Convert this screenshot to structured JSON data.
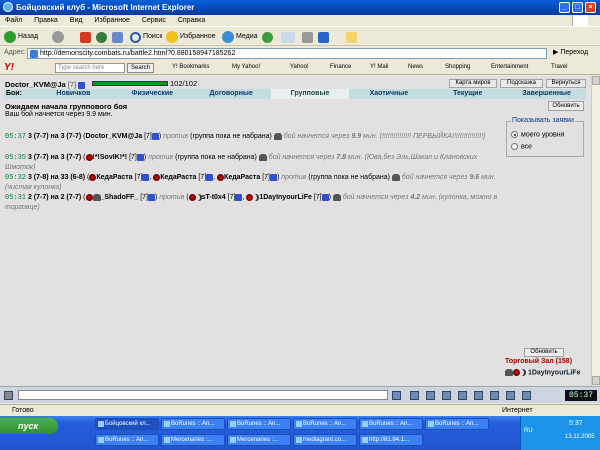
{
  "window": {
    "title": "Бойцовский клуб - Microsoft Internet Explorer"
  },
  "menu": [
    "Файл",
    "Правка",
    "Вид",
    "Избранное",
    "Сервис",
    "Справка"
  ],
  "toolbar": {
    "back": "Назад",
    "search": "Поиск",
    "favorites": "Избранное",
    "media": "Медиа"
  },
  "address": {
    "label": "Адрес:",
    "url": "http://demonscity.combats.ru/battle2.html?0.880158947185262",
    "go": "Переход"
  },
  "yahoo": {
    "logo": "Y!",
    "search_placeholder": "Type search here",
    "search_button": "Search",
    "links": [
      "Y! Bookmarks",
      "My Yahoo!",
      "Yahoo!",
      "Finance",
      "Y! Mail",
      "News",
      "Shopping",
      "Entertainment",
      "Travel"
    ]
  },
  "game": {
    "player": {
      "name": "Doctor_KVM@Ja",
      "level": "[7]",
      "hp": "102/102",
      "hp_fraction": 1.0
    },
    "top_buttons": [
      "Карта миров",
      "Подсказка",
      "Вернуться"
    ],
    "tabs_label": "Бои:",
    "tabs": [
      "Новичков",
      "Физические",
      "Договорные",
      "Групповые",
      "Хаотичные",
      "Текущие",
      "Завершенные"
    ],
    "active_tab": "Групповые",
    "wait_title": "Ожидаем начала группового боя",
    "wait_sub": "Ваш бой начнется через 9.9 мин.",
    "refresh": "Обновить",
    "filter": {
      "legend": "Показывать заявки",
      "opt1": "моего уровня",
      "opt2": "все"
    },
    "battles": [
      {
        "time": "05:37",
        "head": "3 (7-7) на 3 (7-7)",
        "p1": "Doctor_KVM@Ja",
        "p1lvl": "[7]",
        "vs": "против",
        "group": "(группа пока не набрана)",
        "start": "бой начнется через",
        "mins": "9.9",
        "unit": "мин.",
        "comment": "(!!!!!!!!!!!!!!! ПЕРВЫЙКА!!!!!!!!!!!!!!!!)"
      },
      {
        "time": "05:35",
        "head": "3 (7-7) на 3 (7-7)",
        "p1": "!*!SovIK!*!",
        "p1lvl": "[7]",
        "vs": "против",
        "group": "(группа пока не набрана)",
        "start": "бой начнется через",
        "mins": "7.8",
        "unit": "мин.",
        "comment": "(Юва,без Эль,Шакал и Клановских Шмоток)"
      },
      {
        "time": "05:32",
        "head": "3 (7-8) на 33 (6-8)",
        "p1": "КедаРаста",
        "p1lvl": "[7]",
        "p2": "КедаРаста",
        "p2lvl": "[7]",
        "p3": "КедаРаста",
        "p3lvl": "[7]",
        "vs": "против",
        "group": "(группа пока не набрана)",
        "start": "бой начнется через",
        "mins": "9.6",
        "unit": "мин.",
        "comment": "(чистая кулонка)"
      },
      {
        "time": "05:31",
        "head": "2 (7-7) на 2 (7-7)",
        "p1": "_ShadoFF_",
        "p1lvl": "[7]",
        "vs": "против",
        "p2": "sT-t0x4",
        "p2lvl": "[7]",
        "p3": "1DayInyourLiFe",
        "p3lvl": "[7]",
        "start": "бой начнется через",
        "mins": "4.2",
        "unit": "мин.",
        "comment": "(кулонка, можно в торговце)"
      }
    ],
    "hall": {
      "refresh": "Обновить",
      "title": "Торговый Зал (158)",
      "user": "1DayInyourLiFe"
    }
  },
  "chat": {
    "clock": "05:37"
  },
  "status": {
    "done": "Готово",
    "zone": "Интернет"
  },
  "taskbar": {
    "start": "пуск",
    "tasks": [
      "Бойцовский кл...",
      "BoRunes :: An...",
      "BoRunes :: An...",
      "BoRunes :: An...",
      "BoRunes :: An...",
      "BoRunes :: An...",
      "BoRunes :: An...",
      "Mercenaries :...",
      "Mercenaries :...",
      "mediagrant.co...",
      "http://81.94.1..."
    ],
    "lang": "RU",
    "time": "5:37",
    "date": "13.11.2005"
  }
}
